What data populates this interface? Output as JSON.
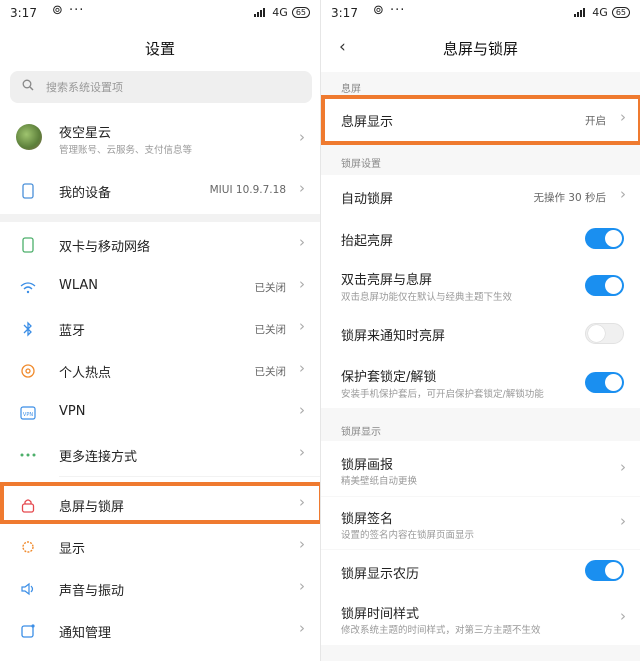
{
  "colors": {
    "accent": "#1a8ff0",
    "highlight": "#ef7a2f"
  },
  "left": {
    "status": {
      "time": "3:17",
      "network": "4G",
      "battery": "65"
    },
    "title": "设置",
    "search": {
      "placeholder": "搜索系统设置项"
    },
    "account": {
      "name": "夜空星云",
      "sub": "管理账号、云服务、支付信息等"
    },
    "device": {
      "label": "我的设备",
      "value": "MIUI 10.9.7.18"
    },
    "items": [
      {
        "icon": "sim-card-icon",
        "label": "双卡与移动网络",
        "value": ""
      },
      {
        "icon": "wifi-icon",
        "label": "WLAN",
        "value": "已关闭"
      },
      {
        "icon": "bluetooth-icon",
        "label": "蓝牙",
        "value": "已关闭"
      },
      {
        "icon": "hotspot-icon",
        "label": "个人热点",
        "value": "已关闭"
      },
      {
        "icon": "vpn-icon",
        "label": "VPN",
        "value": ""
      },
      {
        "icon": "more-connections-icon",
        "label": "更多连接方式",
        "value": ""
      },
      {
        "icon": "lock-icon",
        "label": "息屏与锁屏",
        "value": ""
      },
      {
        "icon": "display-icon",
        "label": "显示",
        "value": ""
      },
      {
        "icon": "speaker-icon",
        "label": "声音与振动",
        "value": ""
      },
      {
        "icon": "notification-icon",
        "label": "通知管理",
        "value": ""
      }
    ]
  },
  "right": {
    "status": {
      "time": "3:17",
      "network": "4G",
      "battery": "65"
    },
    "title": "息屏与锁屏",
    "section1": "息屏",
    "aod": {
      "label": "息屏显示",
      "value": "开启"
    },
    "section2": "锁屏设置",
    "autolock": {
      "label": "自动锁屏",
      "value": "无操作 30 秒后"
    },
    "raise": {
      "label": "抬起亮屏",
      "on": true
    },
    "doubletap": {
      "label": "双击亮屏与息屏",
      "sub": "双击息屏功能仅在默认与经典主题下生效",
      "on": true
    },
    "notify": {
      "label": "锁屏来通知时亮屏",
      "on": false
    },
    "cover": {
      "label": "保护套锁定/解锁",
      "sub": "安装手机保护套后，可开启保护套锁定/解锁功能",
      "on": true
    },
    "section3": "锁屏显示",
    "pictorial": {
      "label": "锁屏画报",
      "sub": "精美壁纸自动更换"
    },
    "signature": {
      "label": "锁屏签名",
      "sub": "设置的签名内容在锁屏页面显示"
    },
    "lunar": {
      "label": "锁屏显示农历",
      "on": true
    },
    "clock": {
      "label": "锁屏时间样式",
      "sub": "修改系统主题的时间样式，对第三方主题不生效"
    }
  }
}
